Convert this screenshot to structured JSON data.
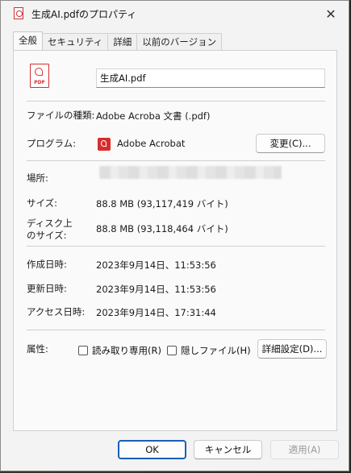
{
  "window": {
    "title": "生成AI.pdfのプロパティ"
  },
  "tabs": [
    {
      "label": "全般"
    },
    {
      "label": "セキュリティ"
    },
    {
      "label": "詳細"
    },
    {
      "label": "以前のバージョン"
    }
  ],
  "file": {
    "name": "生成AI.pdf",
    "icon_label": "PDF"
  },
  "fields": {
    "type_label": "ファイルの種類:",
    "type_value": "Adobe Acroba 文書 (.pdf)",
    "program_label": "プログラム:",
    "program_value": "Adobe Acrobat",
    "change_button": "変更(C)...",
    "location_label": "場所:",
    "size_label": "サイズ:",
    "size_value": "88.8 MB (93,117,419 バイト)",
    "disk_size_label_1": "ディスク上",
    "disk_size_label_2": "のサイズ:",
    "disk_size_value": "88.8 MB (93,118,464 バイト)",
    "created_label": "作成日時:",
    "created_value": "2023年9月14日、11:53:56",
    "modified_label": "更新日時:",
    "modified_value": "2023年9月14日、11:53:56",
    "accessed_label": "アクセス日時:",
    "accessed_value": "2023年9月14日、17:31:44",
    "attributes_label": "属性:",
    "readonly_label": "読み取り専用(R)",
    "hidden_label": "隠しファイル(H)",
    "advanced_button": "詳細設定(D)..."
  },
  "footer": {
    "ok": "OK",
    "cancel": "キャンセル",
    "apply": "適用(A)"
  },
  "colors": {
    "accent": "#1a5fb4",
    "pdf_red": "#d62d2d"
  }
}
